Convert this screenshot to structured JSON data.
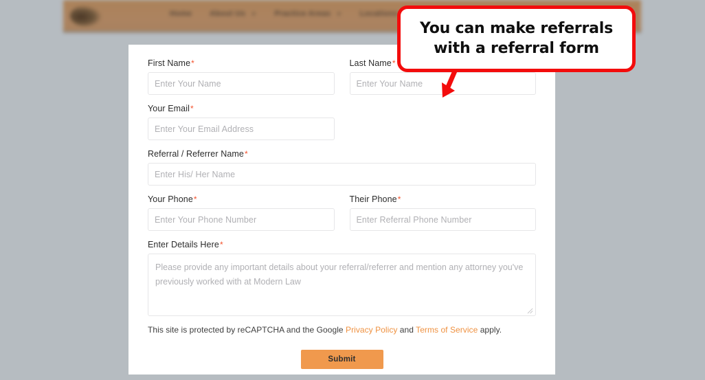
{
  "page": {
    "background_color": "#b6bcc1",
    "card_background": "#ffffff"
  },
  "site_header": {
    "background_color": "#ac8360",
    "logo_name": "site-logo",
    "nav_items": [
      {
        "label": "Home",
        "has_caret": false
      },
      {
        "label": "About Us",
        "has_caret": true
      },
      {
        "label": "Practice Areas",
        "has_caret": true
      },
      {
        "label": "Locations",
        "has_caret": true
      }
    ]
  },
  "callout": {
    "text": "You can make referrals with a referral form",
    "border_color": "#f30c0c",
    "arrow_direction": "down-left"
  },
  "form": {
    "required_marker": "*",
    "required_color": "#f4522d",
    "fields": [
      {
        "name": "first-name",
        "label": "First Name",
        "required": true,
        "placeholder": "Enter Your Name",
        "value": "",
        "type": "text",
        "column": "left"
      },
      {
        "name": "last-name",
        "label": "Last Name",
        "required": true,
        "placeholder": "Enter Your Name",
        "value": "",
        "type": "text",
        "column": "right"
      },
      {
        "name": "your-email",
        "label": "Your Email",
        "required": true,
        "placeholder": "Enter Your Email Address",
        "value": "",
        "type": "email",
        "column": "left"
      },
      {
        "name": "referral-referrer-name",
        "label": "Referral / Referrer Name",
        "required": true,
        "placeholder": "Enter His/ Her Name",
        "value": "",
        "type": "text",
        "column": "full"
      },
      {
        "name": "your-phone",
        "label": "Your Phone",
        "required": true,
        "placeholder": "Enter Your Phone Number",
        "value": "",
        "type": "tel",
        "column": "left"
      },
      {
        "name": "their-phone",
        "label": "Their Phone",
        "required": true,
        "placeholder": "Enter Referral Phone Number",
        "value": "",
        "type": "tel",
        "column": "right"
      },
      {
        "name": "enter-details-here",
        "label": "Enter Details Here",
        "required": true,
        "placeholder": "Please provide any important details about your referral/referrer and mention any attorney you've previously worked with at Modern Law",
        "value": "",
        "type": "textarea",
        "column": "full"
      }
    ],
    "recaptcha_notice": {
      "prefix": "This site is protected by reCAPTCHA and the Google ",
      "link_privacy": "Privacy Policy",
      "middle": " and ",
      "link_terms": "Terms of Service",
      "suffix": " apply.",
      "link_color": "#ef9140"
    },
    "submit": {
      "label": "Submit",
      "background_color": "#f0994d"
    }
  }
}
